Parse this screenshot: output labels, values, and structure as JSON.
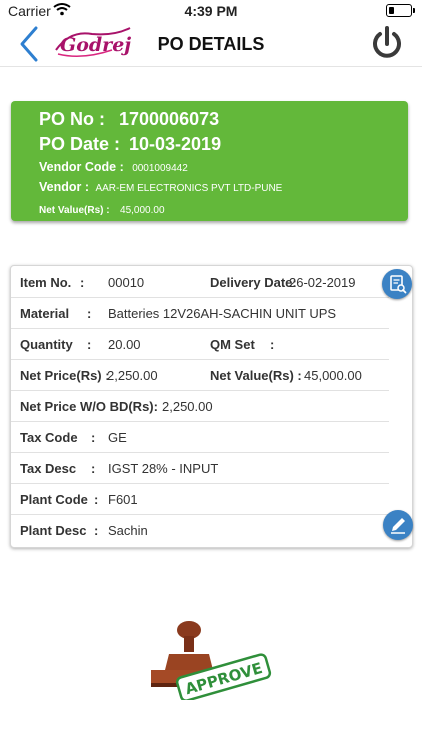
{
  "status_bar": {
    "carrier": "Carrier",
    "time": "4:39 PM"
  },
  "header": {
    "title": "PO DETAILS",
    "logo_text": "Godrej",
    "icons": [
      "back-chevron-icon",
      "power-icon"
    ]
  },
  "po": {
    "po_no_label": "PO No :",
    "po_no": "1700006073",
    "po_date_label": "PO Date :",
    "po_date": "10-03-2019",
    "vendor_code_label": "Vendor Code :",
    "vendor_code": "0001009442",
    "vendor_label": "Vendor :",
    "vendor": "AAR-EM ELECTRONICS PVT LTD-PUNE",
    "net_value_label": "Net Value(Rs) :",
    "net_value": "45,000.00"
  },
  "item": {
    "item_no_label": "Item No.",
    "item_no": "00010",
    "delivery_date_label": "Delivery Date:",
    "delivery_date": "26-02-2019",
    "material_label": "Material",
    "material": "Batteries 12V26AH-SACHIN UNIT UPS",
    "quantity_label": "Quantity",
    "quantity": "20.00",
    "qm_set_label": "QM Set",
    "qm_set": "",
    "net_price_label": "Net Price(Rs) :",
    "net_price": "2,250.00",
    "net_value_label": "Net Value(Rs) :",
    "net_value": "45,000.00",
    "net_price_wo_bd_label": "Net Price W/O BD(Rs):",
    "net_price_wo_bd": "2,250.00",
    "tax_code_label": "Tax Code",
    "tax_code": "GE",
    "tax_desc_label": "Tax Desc",
    "tax_desc": "IGST 28% - INPUT",
    "plant_code_label": "Plant Code",
    "plant_code": "F601",
    "plant_desc_label": "Plant Desc",
    "plant_desc": "Sachin",
    "colon": ":"
  },
  "stamp": {
    "label": "APPROVE"
  },
  "colors": {
    "accent_green": "#63b83a",
    "button_blue": "#3b82c4",
    "logo_magenta": "#a8126a",
    "stamp_wood": "#8a3a1e"
  }
}
